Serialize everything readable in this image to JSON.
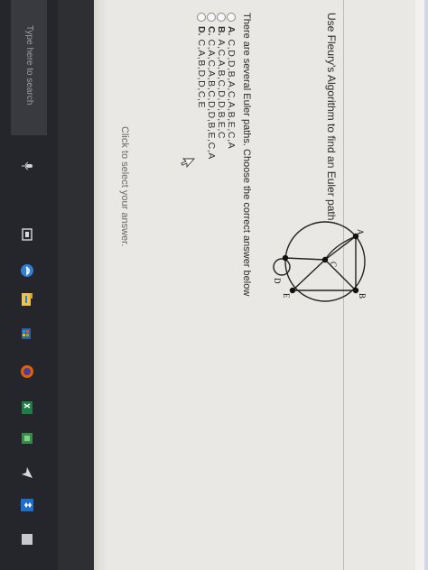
{
  "question": {
    "prompt": "Use Fleury's Algorithm to find an Euler path.",
    "sub_prompt": "There are several Euler paths. Choose the correct answer below",
    "options": [
      {
        "letter": "A.",
        "path": "C,D,D,B,A,C,A,B,E,C,A"
      },
      {
        "letter": "B.",
        "path": "A,C,A,B,C,D,D,B,E,C"
      },
      {
        "letter": "C.",
        "path": "C,A,C,A,B,C,D,D,B,E,C,A"
      },
      {
        "letter": "D.",
        "path": "C,A,B,D,D,C,E"
      }
    ],
    "hint": "Click to select your answer."
  },
  "graph": {
    "vertices": [
      "A",
      "B",
      "C",
      "D",
      "E"
    ]
  },
  "taskbar": {
    "search_placeholder": "Type here to search"
  }
}
